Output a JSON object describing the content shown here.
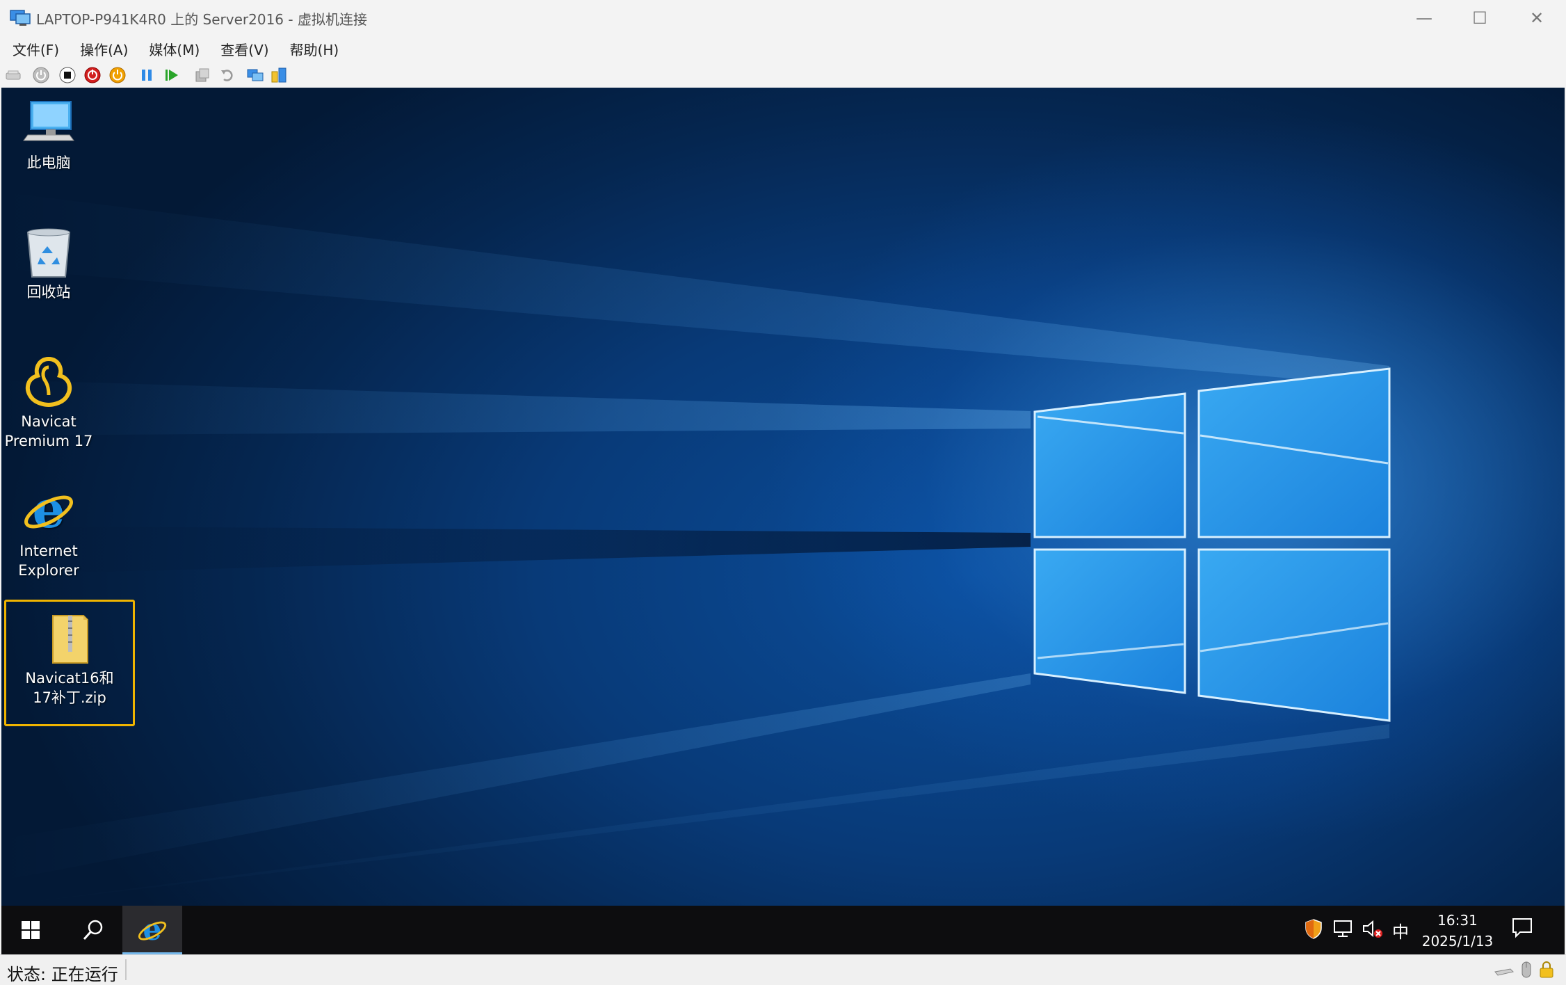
{
  "window": {
    "title": "LAPTOP-P941K4R0 上的 Server2016 - 虚拟机连接",
    "controls": {
      "minimize": "—",
      "maximize": "☐",
      "close": "✕"
    }
  },
  "menu": {
    "items": [
      {
        "label": "文件(F)"
      },
      {
        "label": "操作(A)"
      },
      {
        "label": "媒体(M)"
      },
      {
        "label": "查看(V)"
      },
      {
        "label": "帮助(H)"
      }
    ]
  },
  "toolbar": {
    "icons": [
      "ctrl-alt-del-icon",
      "start-icon",
      "turn-off-icon",
      "shutdown-icon",
      "save-icon",
      "pause-icon",
      "resume-icon",
      "checkpoint-icon",
      "revert-icon",
      "enhanced-session-icon",
      "share-icon"
    ]
  },
  "desktop": {
    "icons": [
      {
        "label": "此电脑",
        "icon": "this-pc-icon"
      },
      {
        "label": "回收站",
        "icon": "recycle-bin-icon"
      },
      {
        "label_line1": "Navicat",
        "label_line2": "Premium 17",
        "icon": "navicat-icon"
      },
      {
        "label_line1": "Internet",
        "label_line2": "Explorer",
        "icon": "internet-explorer-icon"
      },
      {
        "label_line1": "Navicat16和",
        "label_line2": "17补丁.zip",
        "icon": "zip-folder-icon",
        "selected": true
      }
    ],
    "accent_selected": "#f0b400"
  },
  "taskbar": {
    "tray": {
      "ime": "中",
      "time": "16:31",
      "date": "2025/1/13"
    }
  },
  "statusbar": {
    "status": "状态: 正在运行"
  }
}
